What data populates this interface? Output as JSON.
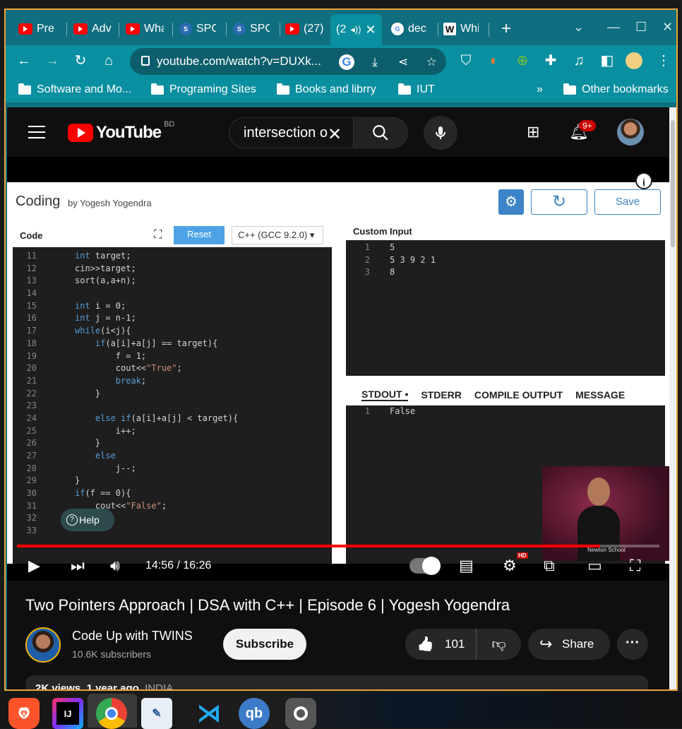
{
  "browser": {
    "tabs": [
      {
        "label": "Pre",
        "icon": "youtube-icon"
      },
      {
        "label": "Adv",
        "icon": "youtube-icon"
      },
      {
        "label": "Wha",
        "icon": "youtube-icon"
      },
      {
        "label": "SPC",
        "icon": "s-icon"
      },
      {
        "label": "SPC",
        "icon": "s-icon"
      },
      {
        "label": "(27)",
        "icon": "youtube-icon"
      },
      {
        "label": "(2",
        "icon": "audio-icon",
        "active": true
      },
      {
        "label": "dec",
        "icon": "google-icon"
      },
      {
        "label": "Whi",
        "icon": "w-icon"
      }
    ],
    "new_tab": "+",
    "url": "youtube.com/watch?v=DUXk...",
    "bookmarks": [
      "Software and Mo...",
      "Programing Sites",
      "Books and librry",
      "IUT"
    ],
    "bookmarks_overflow": "»",
    "other_bookmarks": "Other bookmarks"
  },
  "youtube": {
    "logo_text": "YouTube",
    "region": "BD",
    "search_value": "intersection o",
    "notifications_badge": "9+"
  },
  "coding_page": {
    "title": "Coding",
    "byline": "by Yogesh Yogendra",
    "save_label": "Save",
    "info": "i",
    "code_label": "Code",
    "reset_label": "Reset",
    "language": "C++ (GCC 9.2.0) ▾",
    "help_label": "Help",
    "custom_input_label": "Custom Input",
    "output_tabs": [
      "STDOUT •",
      "STDERR",
      "COMPILE OUTPUT",
      "MESSAGE"
    ],
    "code_lines": [
      {
        "n": "11",
        "t": "int target;"
      },
      {
        "n": "12",
        "t": "cin>>target;"
      },
      {
        "n": "13",
        "t": "sort(a,a+n);"
      },
      {
        "n": "14",
        "t": ""
      },
      {
        "n": "15",
        "t": "int i = 0;"
      },
      {
        "n": "16",
        "t": "int j = n-1;"
      },
      {
        "n": "17",
        "t": "while(i<j){"
      },
      {
        "n": "18",
        "t": "    if(a[i]+a[j] == target){"
      },
      {
        "n": "19",
        "t": "        f = 1;"
      },
      {
        "n": "20",
        "t": "        cout<<\"True\";"
      },
      {
        "n": "21",
        "t": "        break;"
      },
      {
        "n": "22",
        "t": "    }"
      },
      {
        "n": "23",
        "t": ""
      },
      {
        "n": "24",
        "t": "    else if(a[i]+a[j] < target){"
      },
      {
        "n": "25",
        "t": "        i++;"
      },
      {
        "n": "26",
        "t": "    }"
      },
      {
        "n": "27",
        "t": "    else"
      },
      {
        "n": "28",
        "t": "        j--;"
      },
      {
        "n": "29",
        "t": "}"
      },
      {
        "n": "30",
        "t": "if(f == 0){"
      },
      {
        "n": "31",
        "t": "    cout<<\"False\";"
      },
      {
        "n": "32",
        "t": ""
      },
      {
        "n": "33",
        "t": ""
      }
    ],
    "input_lines": [
      {
        "n": "1",
        "t": "5"
      },
      {
        "n": "2",
        "t": "5 3 9 2 1"
      },
      {
        "n": "3",
        "t": "8"
      }
    ],
    "output_lines": [
      {
        "n": "1",
        "t": "False"
      }
    ],
    "webcam_watermark": "Newton School"
  },
  "player": {
    "time": "14:56 / 16:26",
    "progress_fraction": 0.908,
    "hd_badge": "HD"
  },
  "video": {
    "title": "Two Pointers Approach | DSA with C++ | Episode 6 | Yogesh Yogendra",
    "channel_name": "Code Up with TWINS",
    "subscribers": "10.6K subscribers",
    "subscribe_label": "Subscribe",
    "likes": "101",
    "share_label": "Share",
    "more": "···",
    "views": "2K views",
    "age": "1 year ago",
    "country": "INDIA"
  },
  "taskbar": [
    "brave-icon",
    "intellij-icon",
    "chrome-icon",
    "notepad-icon",
    "vscode-icon",
    "qbittorrent-icon",
    "obs-icon"
  ]
}
